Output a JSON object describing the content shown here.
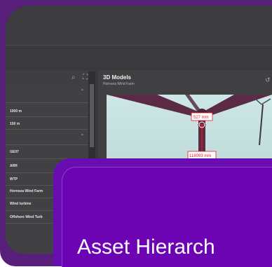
{
  "models_panel": {
    "title": "3D Models",
    "subtitle": "Hornsea Wind Farm"
  },
  "left_panel": {
    "values": [
      "1000 m",
      "150 m"
    ],
    "items": [
      "GE07",
      "ARR",
      "WTP",
      "Hornsea Wind Farm",
      "Wind turbine",
      "Offshore Wind Turb"
    ]
  },
  "measurements": {
    "upper": "527 mm",
    "lower": "118093 mm"
  },
  "overlay": {
    "title": "Asset Hierarch"
  },
  "colors": {
    "frame": "#581f7a",
    "overlay": "#6a0db0",
    "measure": "#e31b23",
    "tower": "#5b2b45"
  },
  "icons": [
    "zoom-icon",
    "expand-icon",
    "chevron-up-icon",
    "reset-view-icon"
  ]
}
